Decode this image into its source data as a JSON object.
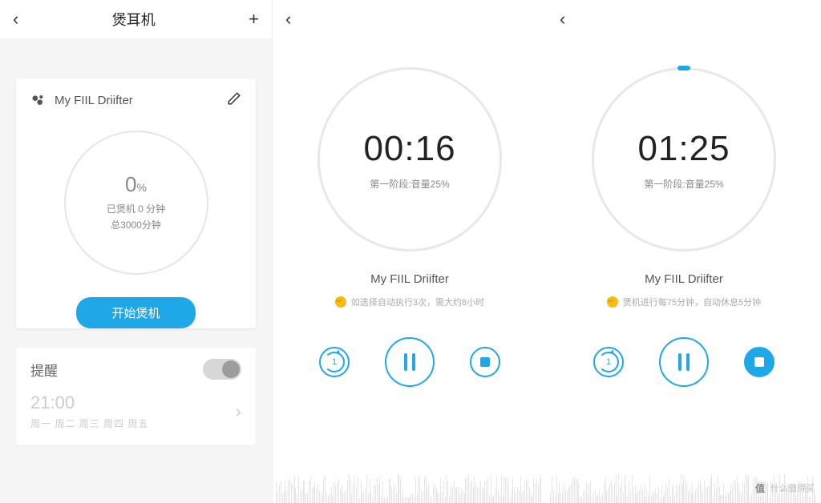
{
  "panel1": {
    "title": "煲耳机",
    "device_name": "My FIIL Driifter",
    "progress": {
      "percent": "0",
      "unit": "%",
      "line1": "已煲机 0 分钟",
      "line2": "总3000分钟"
    },
    "start_button": "开始煲机",
    "reminder": {
      "label": "提醒",
      "toggle_on": false,
      "time": "21:00",
      "days": "周一 周二 周三 周四 周五"
    }
  },
  "panel2": {
    "time": "00:16",
    "stage": "第一阶段:音量25%",
    "device": "My FIIL Driifter",
    "tip": "如选择自动执行3次，需大约8小时",
    "stop_filled": false
  },
  "panel3": {
    "time": "01:25",
    "stage": "第一阶段:音量25%",
    "device": "My FIIL Driifter",
    "tip": "煲机进行每75分钟，自动休息5分钟",
    "stop_filled": true
  },
  "watermark": "什么值得买"
}
